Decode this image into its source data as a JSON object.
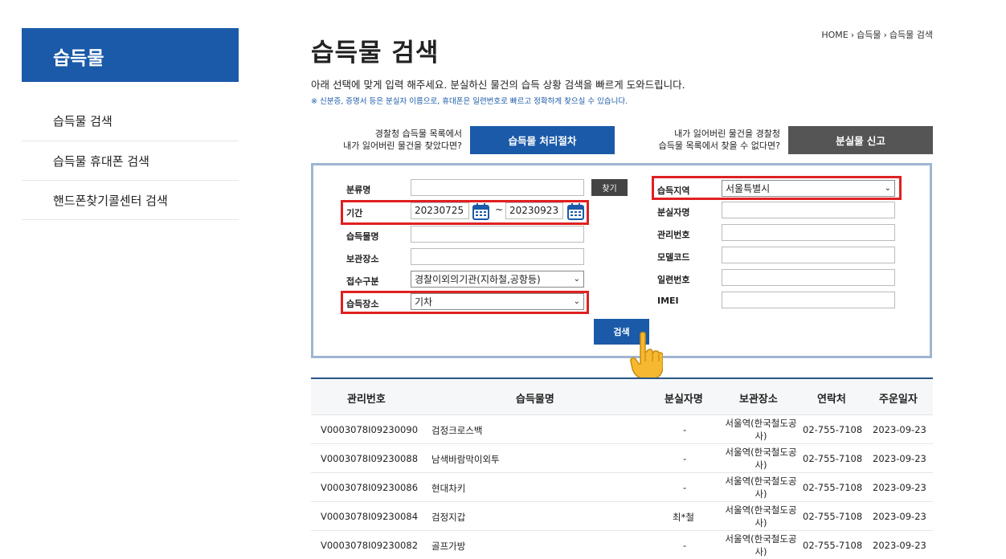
{
  "sidebar": {
    "title": "습득물",
    "items": [
      {
        "label": "습득물 검색"
      },
      {
        "label": "습득물 휴대폰 검색"
      },
      {
        "label": "핸드폰찾기콜센터 검색"
      }
    ]
  },
  "breadcrumb": [
    "HOME",
    "습득물",
    "습득물 검색"
  ],
  "page": {
    "title": "습득물 검색",
    "description": "아래 선택에 맞게 입력 해주세요. 분실하신 물건의 습득 상황 검색을 빠르게 도와드립니다.",
    "note": "※ 신분증, 증명서 등은 분실자 이름으로, 휴대폰은 일련번호로 빠르고 정확하게 찾으실 수 있습니다."
  },
  "actions": {
    "left_text_1": "경찰청 습득물 목록에서",
    "left_text_2": "내가 잃어버린 물건을 찾았다면?",
    "left_button": "습득물 처리절차",
    "right_text_1": "내가 잃어버린 물건을 경찰청",
    "right_text_2": "습득물 목록에서 찾을 수 없다면?",
    "right_button": "분실물 신고"
  },
  "form": {
    "category_label": "분류명",
    "category_value": "",
    "find_button": "찾기",
    "period_label": "기간",
    "date_from": "20230725",
    "date_to": "20230923",
    "tilde": "~",
    "item_name_label": "습득물명",
    "item_name_value": "",
    "storage_label": "보관장소",
    "storage_value": "",
    "receipt_type_label": "접수구분",
    "receipt_type_value": "경찰이외의기관(지하철,공항등)",
    "found_place_label": "습득장소",
    "found_place_value": "기차",
    "region_label": "습득지역",
    "region_value": "서울특별시",
    "loser_name_label": "분실자명",
    "manage_no_label": "관리번호",
    "model_code_label": "모델코드",
    "serial_no_label": "일련번호",
    "imei_label": "IMEI",
    "search_button": "검색"
  },
  "table": {
    "headers": [
      "관리번호",
      "습득물명",
      "분실자명",
      "보관장소",
      "연락처",
      "주운일자"
    ],
    "rows": [
      {
        "id": "V0003078I09230090",
        "name": "검정크로스백",
        "loser": "-",
        "place": "서울역(한국철도공사)",
        "phone": "02-755-7108",
        "date": "2023-09-23"
      },
      {
        "id": "V0003078I09230088",
        "name": "남색바람막이외투",
        "loser": "-",
        "place": "서울역(한국철도공사)",
        "phone": "02-755-7108",
        "date": "2023-09-23"
      },
      {
        "id": "V0003078I09230086",
        "name": "현대차키",
        "loser": "-",
        "place": "서울역(한국철도공사)",
        "phone": "02-755-7108",
        "date": "2023-09-23"
      },
      {
        "id": "V0003078I09230084",
        "name": "검정지갑",
        "loser": "최*철",
        "place": "서울역(한국철도공사)",
        "phone": "02-755-7108",
        "date": "2023-09-23"
      },
      {
        "id": "V0003078I09230082",
        "name": "골프가방",
        "loser": "-",
        "place": "서울역(한국철도공사)",
        "phone": "02-755-7108",
        "date": "2023-09-23"
      }
    ]
  },
  "colors": {
    "brand": "#1a5aa8",
    "highlight": "#e02020",
    "gray_button": "#555555"
  }
}
